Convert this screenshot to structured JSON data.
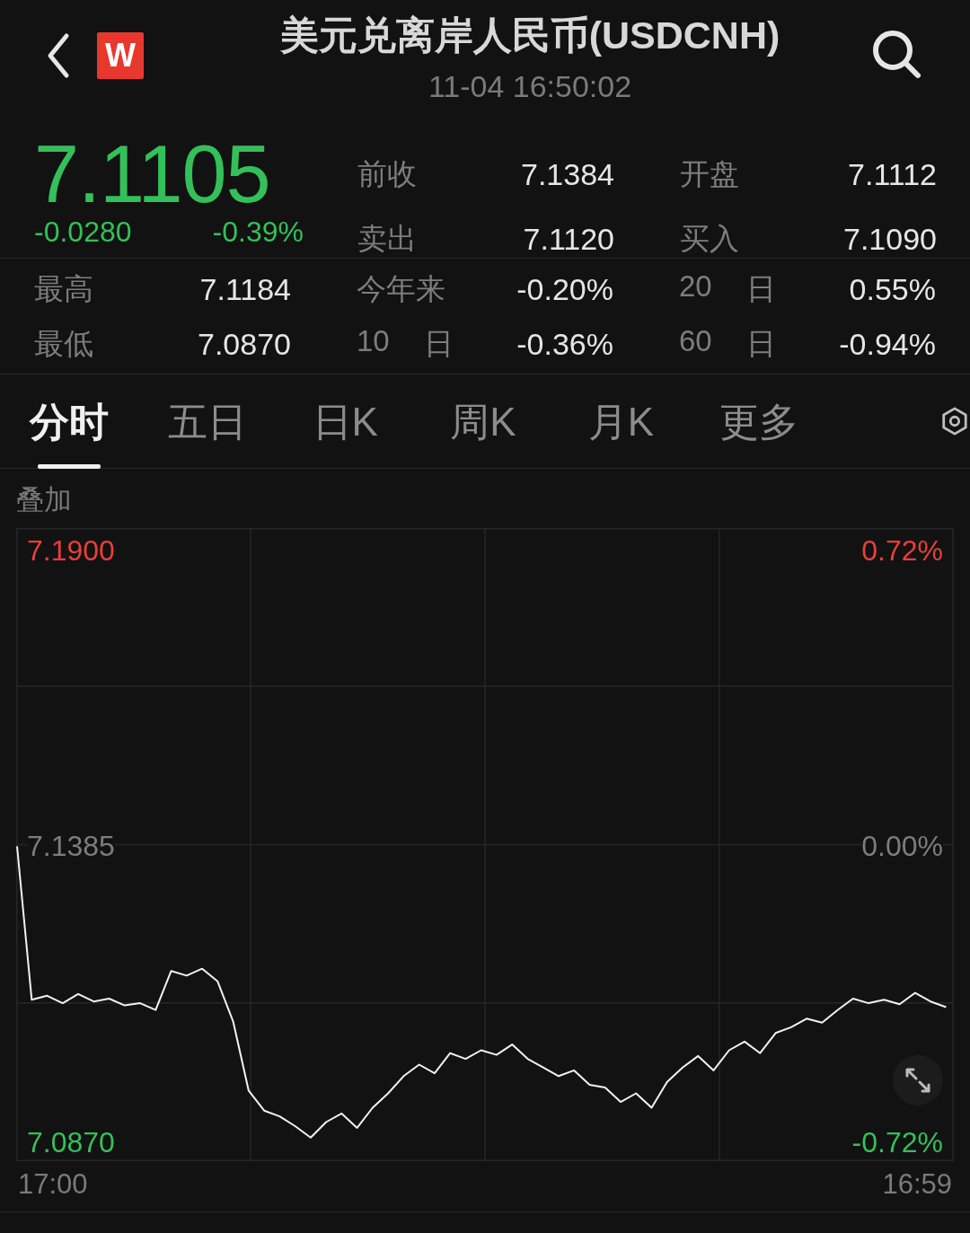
{
  "header": {
    "logo_text": "W",
    "title": "美元兑离岸人民币(USDCNH)",
    "time": "11-04 16:50:02"
  },
  "quote": {
    "price": "7.1105",
    "change": "-0.0280",
    "change_pct": "-0.39%",
    "color": "#33c05a",
    "fields": [
      {
        "label": "前收",
        "value": "7.1384"
      },
      {
        "label": "开盘",
        "value": "7.1112"
      },
      {
        "label": "卖出",
        "value": "7.1120"
      },
      {
        "label": "买入",
        "value": "7.1090"
      }
    ]
  },
  "stats": [
    {
      "label": "最高",
      "value": "7.1184"
    },
    {
      "label": "今年来",
      "value": "-0.20%"
    },
    {
      "period": "20",
      "unit": "日",
      "value": "0.55%"
    },
    {
      "label": "最低",
      "value": "7.0870"
    },
    {
      "period": "10",
      "unit": "日",
      "value": "-0.36%"
    },
    {
      "period": "60",
      "unit": "日",
      "value": "-0.94%"
    }
  ],
  "tabs": [
    {
      "label": "分时",
      "selected": true
    },
    {
      "label": "五日",
      "selected": false
    },
    {
      "label": "日K",
      "selected": false
    },
    {
      "label": "周K",
      "selected": false
    },
    {
      "label": "月K",
      "selected": false
    },
    {
      "label": "更多",
      "selected": false
    }
  ],
  "overlay_label": "叠加",
  "chart": {
    "y_left": [
      {
        "color": "#ea3f3a"
      },
      {
        "color": "#7d7d7d"
      },
      {
        "color": "#33c05a"
      }
    ],
    "y_right": [
      {
        "text": "0.72%",
        "color": "#ea3f3a"
      },
      {
        "text": "0.00%",
        "color": "#7d7d7d"
      },
      {
        "text": "-0.72%",
        "color": "#33c05a"
      }
    ],
    "x_labels": [
      "17:00",
      "16:59"
    ],
    "chart_data": {
      "type": "line",
      "ylim": [
        7.0837,
        7.1939
      ],
      "grid": true,
      "yticks": [
        {
          "value": 7.19,
          "label": "7.1900"
        },
        {
          "value": 7.1385,
          "label": "7.1385"
        },
        {
          "value": 7.087,
          "label": "7.0870"
        }
      ],
      "series": [
        {
          "color": "#f2f2f2",
          "values": [
            7.1385,
            7.1118,
            7.1125,
            7.1112,
            7.1128,
            7.1115,
            7.112,
            7.1108,
            7.1112,
            7.11,
            7.1168,
            7.116,
            7.1172,
            7.115,
            7.108,
            7.096,
            7.0925,
            7.0915,
            7.0898,
            7.0878,
            7.0905,
            7.092,
            7.0895,
            7.093,
            7.0955,
            7.0985,
            7.1005,
            7.099,
            7.1025,
            7.1015,
            7.103,
            7.1022,
            7.104,
            7.1015,
            7.1,
            7.0985,
            7.0995,
            7.097,
            7.0965,
            7.094,
            7.0955,
            7.093,
            7.0975,
            7.1,
            7.102,
            7.0995,
            7.103,
            7.1045,
            7.1025,
            7.106,
            7.107,
            7.1085,
            7.1078,
            7.11,
            7.112,
            7.1112,
            7.1118,
            7.111,
            7.113,
            7.1115,
            7.1105
          ]
        }
      ]
    }
  }
}
